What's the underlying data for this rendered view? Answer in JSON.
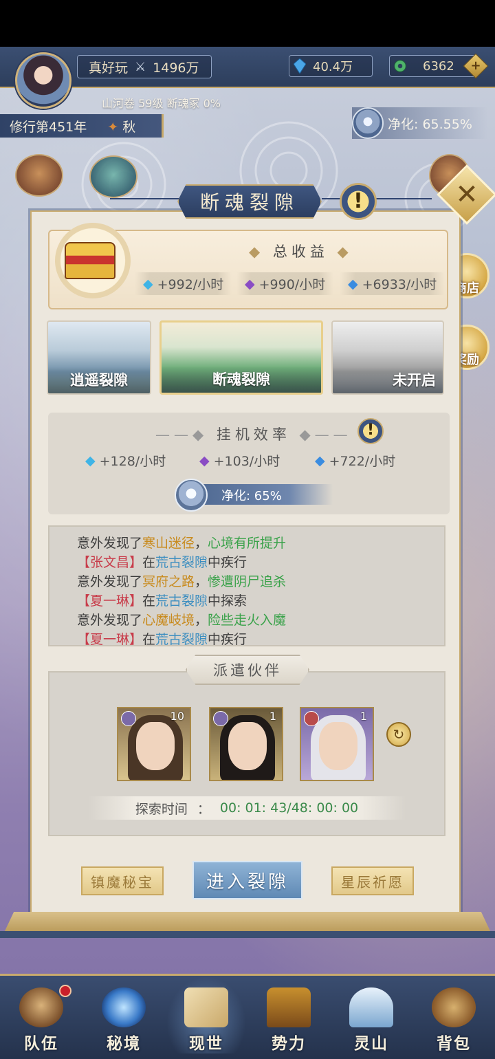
{
  "header": {
    "player_name": "真好玩",
    "power": "1496万",
    "resource_1": "40.4万",
    "resource_2": "6362",
    "sub_info": "山河卷 59级 断魂冢 0%",
    "year": "修行第451年",
    "season": "秋",
    "purify_label": "净化: 65.55%"
  },
  "side_buttons": {
    "shop": "商店",
    "reward": "奖励"
  },
  "panel": {
    "title": "断魂裂隙",
    "total_income_title": "总收益",
    "total_income": [
      "+992/小时",
      "+990/小时",
      "+6933/小时"
    ],
    "rifts": [
      {
        "label": "逍遥裂隙"
      },
      {
        "label": "断魂裂隙"
      },
      {
        "label": "未开启"
      }
    ],
    "efficiency_title": "挂机效率",
    "efficiency": [
      "+128/小时",
      "+103/小时",
      "+722/小时"
    ],
    "purify_bar": "净化: 65%",
    "log": [
      [
        {
          "t": "意外发现了",
          "c": ""
        },
        {
          "t": "寒山迷径",
          "c": "c-place"
        },
        {
          "t": "，",
          "c": ""
        },
        {
          "t": "心境有所提升",
          "c": "c-good"
        }
      ],
      [
        {
          "t": "【张文昌】",
          "c": "c-name"
        },
        {
          "t": "在",
          "c": ""
        },
        {
          "t": "荒古裂隙",
          "c": "c-rift"
        },
        {
          "t": "中疾行",
          "c": ""
        }
      ],
      [
        {
          "t": "意外发现了",
          "c": ""
        },
        {
          "t": "冥府之路",
          "c": "c-place"
        },
        {
          "t": "，",
          "c": ""
        },
        {
          "t": "惨遭阴尸追杀",
          "c": "c-bad"
        }
      ],
      [
        {
          "t": "【夏一琳】",
          "c": "c-name"
        },
        {
          "t": "在",
          "c": ""
        },
        {
          "t": "荒古裂隙",
          "c": "c-rift"
        },
        {
          "t": "中探索",
          "c": ""
        }
      ],
      [
        {
          "t": "意外发现了",
          "c": ""
        },
        {
          "t": "心魔岐境",
          "c": "c-place"
        },
        {
          "t": "，",
          "c": ""
        },
        {
          "t": "险些走火入魔",
          "c": "c-bad"
        }
      ],
      [
        {
          "t": "【夏一琳】",
          "c": "c-name"
        },
        {
          "t": "在",
          "c": ""
        },
        {
          "t": "荒古裂隙",
          "c": "c-rift"
        },
        {
          "t": "中疾行",
          "c": ""
        }
      ]
    ],
    "dispatch_title": "派遣伙伴",
    "partners": [
      {
        "level": "10"
      },
      {
        "level": "1"
      },
      {
        "level": "1"
      }
    ],
    "explore_time_label": "探索时间",
    "explore_time_sep": "：",
    "explore_time_value": "00: 01: 43/48: 00: 00",
    "btn_left": "镇魔秘宝",
    "btn_enter": "进入裂隙",
    "btn_right": "星辰祈愿"
  },
  "bottom_nav": [
    {
      "label": "队伍",
      "icon": "team-icon"
    },
    {
      "label": "秘境",
      "icon": "secret-realm-icon"
    },
    {
      "label": "现世",
      "icon": "world-map-icon"
    },
    {
      "label": "势力",
      "icon": "faction-icon"
    },
    {
      "label": "灵山",
      "icon": "spirit-mountain-icon"
    },
    {
      "label": "背包",
      "icon": "bag-icon"
    }
  ],
  "colors": {
    "accent_gold": "#c9ab6e",
    "nav_blue": "#3a4d70",
    "good_green": "#3aa24a",
    "name_red": "#c83c4a",
    "rift_blue": "#3c8ec0",
    "place_orange": "#c88a1c"
  }
}
